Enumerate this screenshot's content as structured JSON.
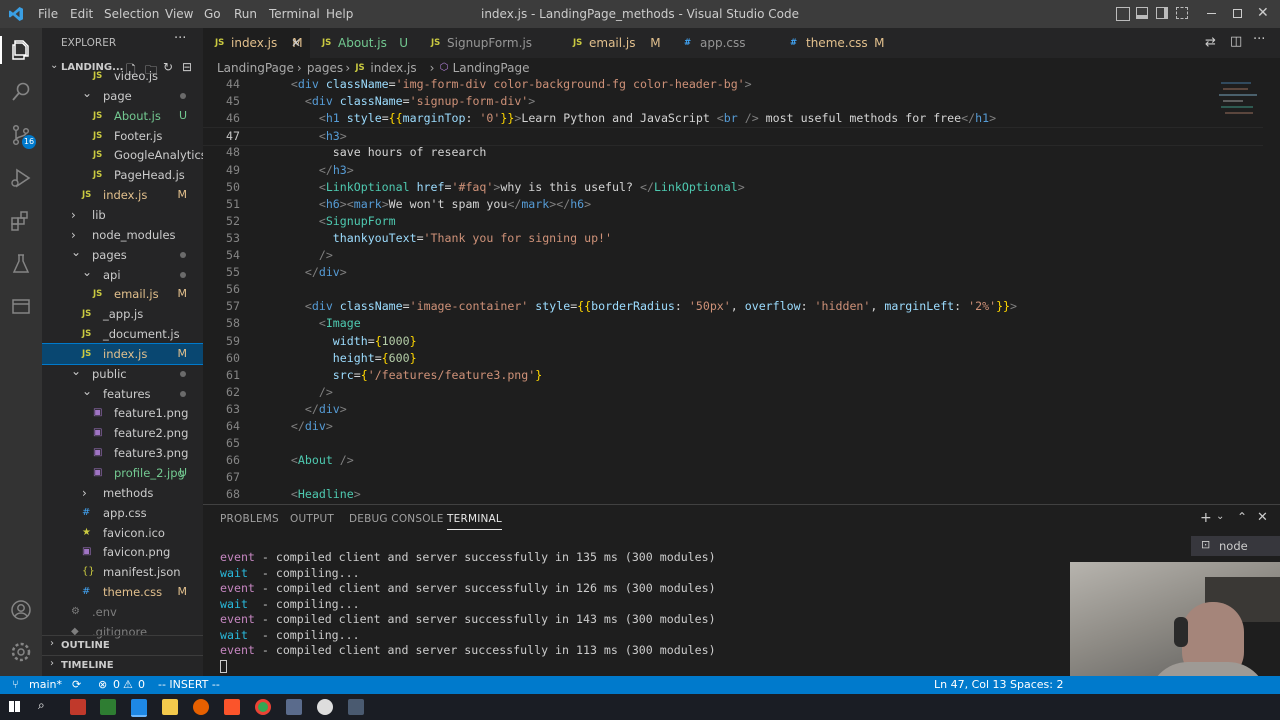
{
  "window": {
    "title": "index.js - LandingPage_methods - Visual Studio Code",
    "menu": [
      "File",
      "Edit",
      "Selection",
      "View",
      "Go",
      "Run",
      "Terminal",
      "Help"
    ]
  },
  "activity_bar": {
    "items": [
      "explorer-icon",
      "search-icon",
      "source-control-icon",
      "run-debug-icon",
      "extensions-icon",
      "testing-icon",
      "remote-explorer-icon"
    ],
    "scm_badge": "16",
    "bottom": [
      "account-icon",
      "settings-gear-icon"
    ]
  },
  "sidebar": {
    "header": "EXPLORER",
    "root": "LANDING...",
    "tree": [
      {
        "label": "video.js",
        "indent": 3,
        "type": "js",
        "status": ""
      },
      {
        "label": "page",
        "indent": 2,
        "type": "folder-open",
        "status": "dot"
      },
      {
        "label": "About.js",
        "indent": 3,
        "type": "js",
        "status": "U"
      },
      {
        "label": "Footer.js",
        "indent": 3,
        "type": "js",
        "status": ""
      },
      {
        "label": "GoogleAnalytics.js",
        "indent": 3,
        "type": "js",
        "status": ""
      },
      {
        "label": "PageHead.js",
        "indent": 3,
        "type": "js",
        "status": ""
      },
      {
        "label": "index.js",
        "indent": 2,
        "type": "js",
        "status": "M"
      },
      {
        "label": "lib",
        "indent": 1,
        "type": "folder",
        "status": ""
      },
      {
        "label": "node_modules",
        "indent": 1,
        "type": "folder",
        "status": ""
      },
      {
        "label": "pages",
        "indent": 1,
        "type": "folder-open",
        "status": "dot"
      },
      {
        "label": "api",
        "indent": 2,
        "type": "folder-open",
        "status": "dot"
      },
      {
        "label": "email.js",
        "indent": 3,
        "type": "js",
        "status": "M"
      },
      {
        "label": "_app.js",
        "indent": 2,
        "type": "js",
        "status": ""
      },
      {
        "label": "_document.js",
        "indent": 2,
        "type": "js",
        "status": ""
      },
      {
        "label": "index.js",
        "indent": 2,
        "type": "js",
        "status": "M",
        "selected": true
      },
      {
        "label": "public",
        "indent": 1,
        "type": "folder-open",
        "status": "dot"
      },
      {
        "label": "features",
        "indent": 2,
        "type": "folder-open",
        "status": "dot"
      },
      {
        "label": "feature1.png",
        "indent": 3,
        "type": "img",
        "status": ""
      },
      {
        "label": "feature2.png",
        "indent": 3,
        "type": "img",
        "status": ""
      },
      {
        "label": "feature3.png",
        "indent": 3,
        "type": "img",
        "status": ""
      },
      {
        "label": "profile_2.jpg",
        "indent": 3,
        "type": "img",
        "status": "U"
      },
      {
        "label": "methods",
        "indent": 2,
        "type": "folder",
        "status": ""
      },
      {
        "label": "app.css",
        "indent": 2,
        "type": "css",
        "status": ""
      },
      {
        "label": "favicon.ico",
        "indent": 2,
        "type": "star",
        "status": ""
      },
      {
        "label": "favicon.png",
        "indent": 2,
        "type": "img",
        "status": ""
      },
      {
        "label": "manifest.json",
        "indent": 2,
        "type": "json",
        "status": ""
      },
      {
        "label": "theme.css",
        "indent": 2,
        "type": "css",
        "status": "M"
      },
      {
        "label": ".env",
        "indent": 1,
        "type": "gear",
        "status": ""
      },
      {
        "label": ".gitignore",
        "indent": 1,
        "type": "git",
        "status": ""
      }
    ],
    "outline": "OUTLINE",
    "timeline": "TIMELINE"
  },
  "tabs": [
    {
      "label": "index.js",
      "status": "M",
      "active": true,
      "icon": "JS"
    },
    {
      "label": "About.js",
      "status": "U",
      "active": false,
      "icon": "JS"
    },
    {
      "label": "SignupForm.js",
      "status": "",
      "active": false,
      "icon": "JS"
    },
    {
      "label": "email.js",
      "status": "M",
      "active": false,
      "icon": "JS"
    },
    {
      "label": "app.css",
      "status": "",
      "active": false,
      "icon": "#"
    },
    {
      "label": "theme.css",
      "status": "M",
      "active": false,
      "icon": "#"
    }
  ],
  "breadcrumbs": [
    "LandingPage",
    "pages",
    "index.js",
    "LandingPage"
  ],
  "code": {
    "lines": [
      {
        "n": "44",
        "parts": [
          [
            "pu",
            "    <"
          ],
          [
            "tg",
            "div"
          ],
          [
            "at",
            " className"
          ],
          [
            "tx",
            "="
          ],
          [
            "sv",
            "'img-form-div color-background-fg color-header-bg'"
          ],
          [
            "pu",
            ">"
          ]
        ]
      },
      {
        "n": "45",
        "parts": [
          [
            "pu",
            "      <"
          ],
          [
            "tg",
            "div"
          ],
          [
            "at",
            " className"
          ],
          [
            "tx",
            "="
          ],
          [
            "sv",
            "'signup-form-div'"
          ],
          [
            "pu",
            ">"
          ]
        ]
      },
      {
        "n": "46",
        "parts": [
          [
            "pu",
            "        <"
          ],
          [
            "tg",
            "h1"
          ],
          [
            "at",
            " style"
          ],
          [
            "tx",
            "="
          ],
          [
            "br",
            "{{"
          ],
          [
            "at",
            "marginTop"
          ],
          [
            "tx",
            ": "
          ],
          [
            "sv",
            "'0'"
          ],
          [
            "br",
            "}}"
          ],
          [
            "pu",
            ">"
          ],
          [
            "tx",
            "Learn Python and JavaScript "
          ],
          [
            "pu",
            "<"
          ],
          [
            "tg",
            "br"
          ],
          [
            "pu",
            " /> "
          ],
          [
            "tx",
            "most useful methods for free"
          ],
          [
            "pu",
            "</"
          ],
          [
            "tg",
            "h1"
          ],
          [
            "pu",
            ">"
          ]
        ]
      },
      {
        "n": "47",
        "parts": [
          [
            "pu",
            "        <"
          ],
          [
            "tg",
            "h3"
          ],
          [
            "pu",
            ">"
          ]
        ]
      },
      {
        "n": "48",
        "parts": [
          [
            "tx",
            "          save hours of research"
          ]
        ]
      },
      {
        "n": "49",
        "parts": [
          [
            "pu",
            "        </"
          ],
          [
            "tg",
            "h3"
          ],
          [
            "pu",
            ">"
          ]
        ]
      },
      {
        "n": "50",
        "parts": [
          [
            "pu",
            "        <"
          ],
          [
            "tn",
            "LinkOptional"
          ],
          [
            "at",
            " href"
          ],
          [
            "tx",
            "="
          ],
          [
            "sv",
            "'#faq'"
          ],
          [
            "pu",
            ">"
          ],
          [
            "tx",
            "why is this useful? "
          ],
          [
            "pu",
            "</"
          ],
          [
            "tn",
            "LinkOptional"
          ],
          [
            "pu",
            ">"
          ]
        ]
      },
      {
        "n": "51",
        "parts": [
          [
            "pu",
            "        <"
          ],
          [
            "tg",
            "h6"
          ],
          [
            "pu",
            "><"
          ],
          [
            "tg",
            "mark"
          ],
          [
            "pu",
            ">"
          ],
          [
            "tx",
            "We won't spam you"
          ],
          [
            "pu",
            "</"
          ],
          [
            "tg",
            "mark"
          ],
          [
            "pu",
            "></"
          ],
          [
            "tg",
            "h6"
          ],
          [
            "pu",
            ">"
          ]
        ]
      },
      {
        "n": "52",
        "parts": [
          [
            "pu",
            "        <"
          ],
          [
            "tn",
            "SignupForm"
          ]
        ]
      },
      {
        "n": "53",
        "parts": [
          [
            "at",
            "          thankyouText"
          ],
          [
            "tx",
            "="
          ],
          [
            "sv",
            "'Thank you for signing up!'"
          ]
        ]
      },
      {
        "n": "54",
        "parts": [
          [
            "pu",
            "        />"
          ]
        ]
      },
      {
        "n": "55",
        "parts": [
          [
            "pu",
            "      </"
          ],
          [
            "tg",
            "div"
          ],
          [
            "pu",
            ">"
          ]
        ]
      },
      {
        "n": "56",
        "parts": [
          [
            "tx",
            ""
          ]
        ]
      },
      {
        "n": "57",
        "parts": [
          [
            "pu",
            "      <"
          ],
          [
            "tg",
            "div"
          ],
          [
            "at",
            " className"
          ],
          [
            "tx",
            "="
          ],
          [
            "sv",
            "'image-container'"
          ],
          [
            "at",
            " style"
          ],
          [
            "tx",
            "="
          ],
          [
            "br",
            "{{"
          ],
          [
            "at",
            "borderRadius"
          ],
          [
            "tx",
            ": "
          ],
          [
            "sv",
            "'50px'"
          ],
          [
            "tx",
            ", "
          ],
          [
            "at",
            "overflow"
          ],
          [
            "tx",
            ": "
          ],
          [
            "sv",
            "'hidden'"
          ],
          [
            "tx",
            ", "
          ],
          [
            "at",
            "marginLeft"
          ],
          [
            "tx",
            ": "
          ],
          [
            "sv",
            "'2%'"
          ],
          [
            "br",
            "}}"
          ],
          [
            "pu",
            ">"
          ]
        ]
      },
      {
        "n": "58",
        "parts": [
          [
            "pu",
            "        <"
          ],
          [
            "tn",
            "Image"
          ]
        ]
      },
      {
        "n": "59",
        "parts": [
          [
            "at",
            "          width"
          ],
          [
            "tx",
            "="
          ],
          [
            "br",
            "{"
          ],
          [
            "nm",
            "1000"
          ],
          [
            "br",
            "}"
          ]
        ]
      },
      {
        "n": "60",
        "parts": [
          [
            "at",
            "          height"
          ],
          [
            "tx",
            "="
          ],
          [
            "br",
            "{"
          ],
          [
            "nm",
            "600"
          ],
          [
            "br",
            "}"
          ]
        ]
      },
      {
        "n": "61",
        "parts": [
          [
            "at",
            "          src"
          ],
          [
            "tx",
            "="
          ],
          [
            "br",
            "{"
          ],
          [
            "sv",
            "'/features/feature3.png'"
          ],
          [
            "br",
            "}"
          ]
        ]
      },
      {
        "n": "62",
        "parts": [
          [
            "pu",
            "        />"
          ]
        ]
      },
      {
        "n": "63",
        "parts": [
          [
            "pu",
            "      </"
          ],
          [
            "tg",
            "div"
          ],
          [
            "pu",
            ">"
          ]
        ]
      },
      {
        "n": "64",
        "parts": [
          [
            "pu",
            "    </"
          ],
          [
            "tg",
            "div"
          ],
          [
            "pu",
            ">"
          ]
        ]
      },
      {
        "n": "65",
        "parts": [
          [
            "tx",
            ""
          ]
        ]
      },
      {
        "n": "66",
        "parts": [
          [
            "pu",
            "    <"
          ],
          [
            "tn",
            "About"
          ],
          [
            "pu",
            " />"
          ]
        ]
      },
      {
        "n": "67",
        "parts": [
          [
            "tx",
            ""
          ]
        ]
      },
      {
        "n": "68",
        "parts": [
          [
            "pu",
            "    <"
          ],
          [
            "tn",
            "Headline"
          ],
          [
            "pu",
            ">"
          ]
        ]
      }
    ]
  },
  "panel": {
    "tabs": [
      "PROBLEMS",
      "OUTPUT",
      "DEBUG CONSOLE",
      "TERMINAL"
    ],
    "active_tab": "TERMINAL",
    "terminal_name": "node",
    "lines": [
      {
        "kind": "event",
        "text": " - compiled client and server successfully in 135 ms (300 modules)"
      },
      {
        "kind": "wait",
        "text": "  - compiling..."
      },
      {
        "kind": "event",
        "text": " - compiled client and server successfully in 126 ms (300 modules)"
      },
      {
        "kind": "wait",
        "text": "  - compiling..."
      },
      {
        "kind": "event",
        "text": " - compiled client and server successfully in 143 ms (300 modules)"
      },
      {
        "kind": "wait",
        "text": "  - compiling..."
      },
      {
        "kind": "event",
        "text": " - compiled client and server successfully in 113 ms (300 modules)"
      }
    ]
  },
  "status_bar": {
    "branch": "main*",
    "errors": "0",
    "warnings": "0",
    "mode": "-- INSERT --",
    "position": "Ln 47, Col 13",
    "indent": "Spaces: 2"
  },
  "colors": {
    "accent": "#007acc",
    "selection": "#094771",
    "modified": "#e2c08d",
    "untracked": "#73c991"
  }
}
